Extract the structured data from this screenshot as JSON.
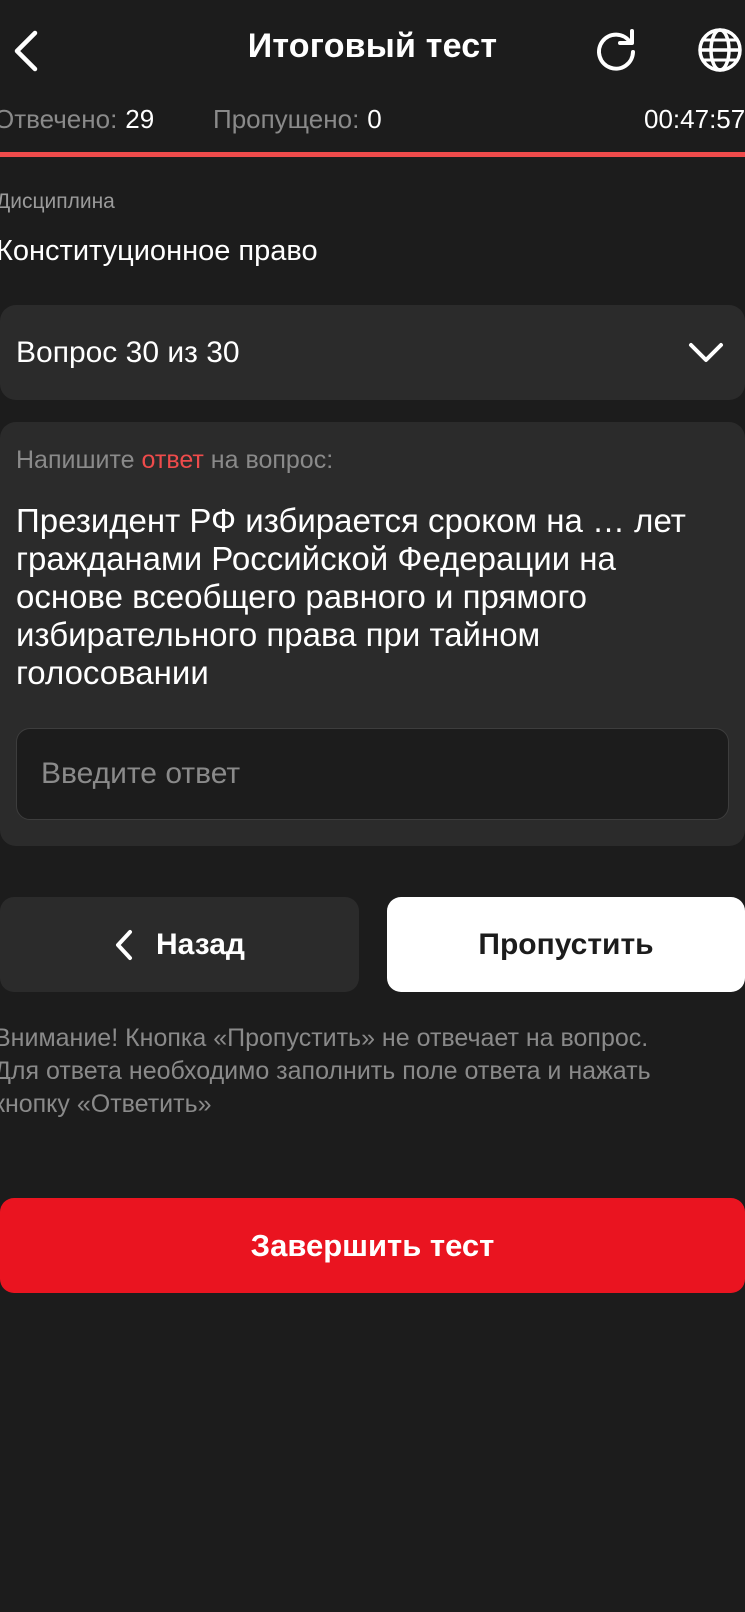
{
  "header": {
    "title": "Итоговый тест",
    "back_icon": "chevron-left-icon",
    "refresh_icon": "refresh-icon",
    "language_icon": "globe-icon"
  },
  "stats": {
    "answered_label": "Отвечено:",
    "answered_value": "29",
    "skipped_label": "Пропущено:",
    "skipped_value": "0",
    "timer": "00:47:57"
  },
  "progress": {
    "fraction": 1.0,
    "color": "#ef4b4b"
  },
  "discipline": {
    "label": "Дисциплина",
    "value": "Конституционное право"
  },
  "question_select": {
    "label": "Вопрос 30 из 30",
    "icon": "chevron-down-icon"
  },
  "question": {
    "prompt_before": "Напишите ",
    "prompt_accent": "ответ",
    "prompt_after": " на вопрос:",
    "text": "Президент РФ избирается сроком на … лет гражданами Российской Федерации на основе всеобщего равного и прямого избирательного права при тайном голосовании",
    "answer_value": "",
    "answer_placeholder": "Введите ответ"
  },
  "navigation": {
    "back_label": "Назад",
    "skip_label": "Пропустить"
  },
  "warning": {
    "line1": "Внимание! Кнопка «Пропустить» не отвечает на вопрос.",
    "line2": "Для ответа необходимо заполнить поле ответа и нажать",
    "line3": "кнопку «Ответить»"
  },
  "finish": {
    "label": "Завершить тест"
  },
  "colors": {
    "background": "#1c1c1c",
    "card": "#2b2b2b",
    "accent_red": "#ef4b4b",
    "finish_red": "#ea1420",
    "muted_text": "#8a8a8a"
  }
}
